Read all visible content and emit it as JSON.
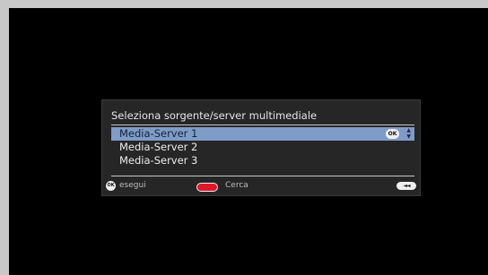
{
  "dialog": {
    "title": "Seleziona sorgente/server multimediale",
    "items": [
      {
        "label": "Media-Server 1",
        "selected": true
      },
      {
        "label": "Media-Server 2",
        "selected": false
      },
      {
        "label": "Media-Server 3",
        "selected": false
      }
    ],
    "selected_hint": {
      "ok_icon": "OK",
      "updown_icon": "▲\n▼"
    }
  },
  "footer": {
    "ok_icon": "OK",
    "ok_label": "esegui",
    "red_label": "Cerca",
    "back_icon": "◄◄"
  },
  "colors": {
    "screen_bg": "#000000",
    "dialog_bg": "#262626",
    "highlight": "#7f9cc8",
    "red_button": "#e0162b"
  }
}
